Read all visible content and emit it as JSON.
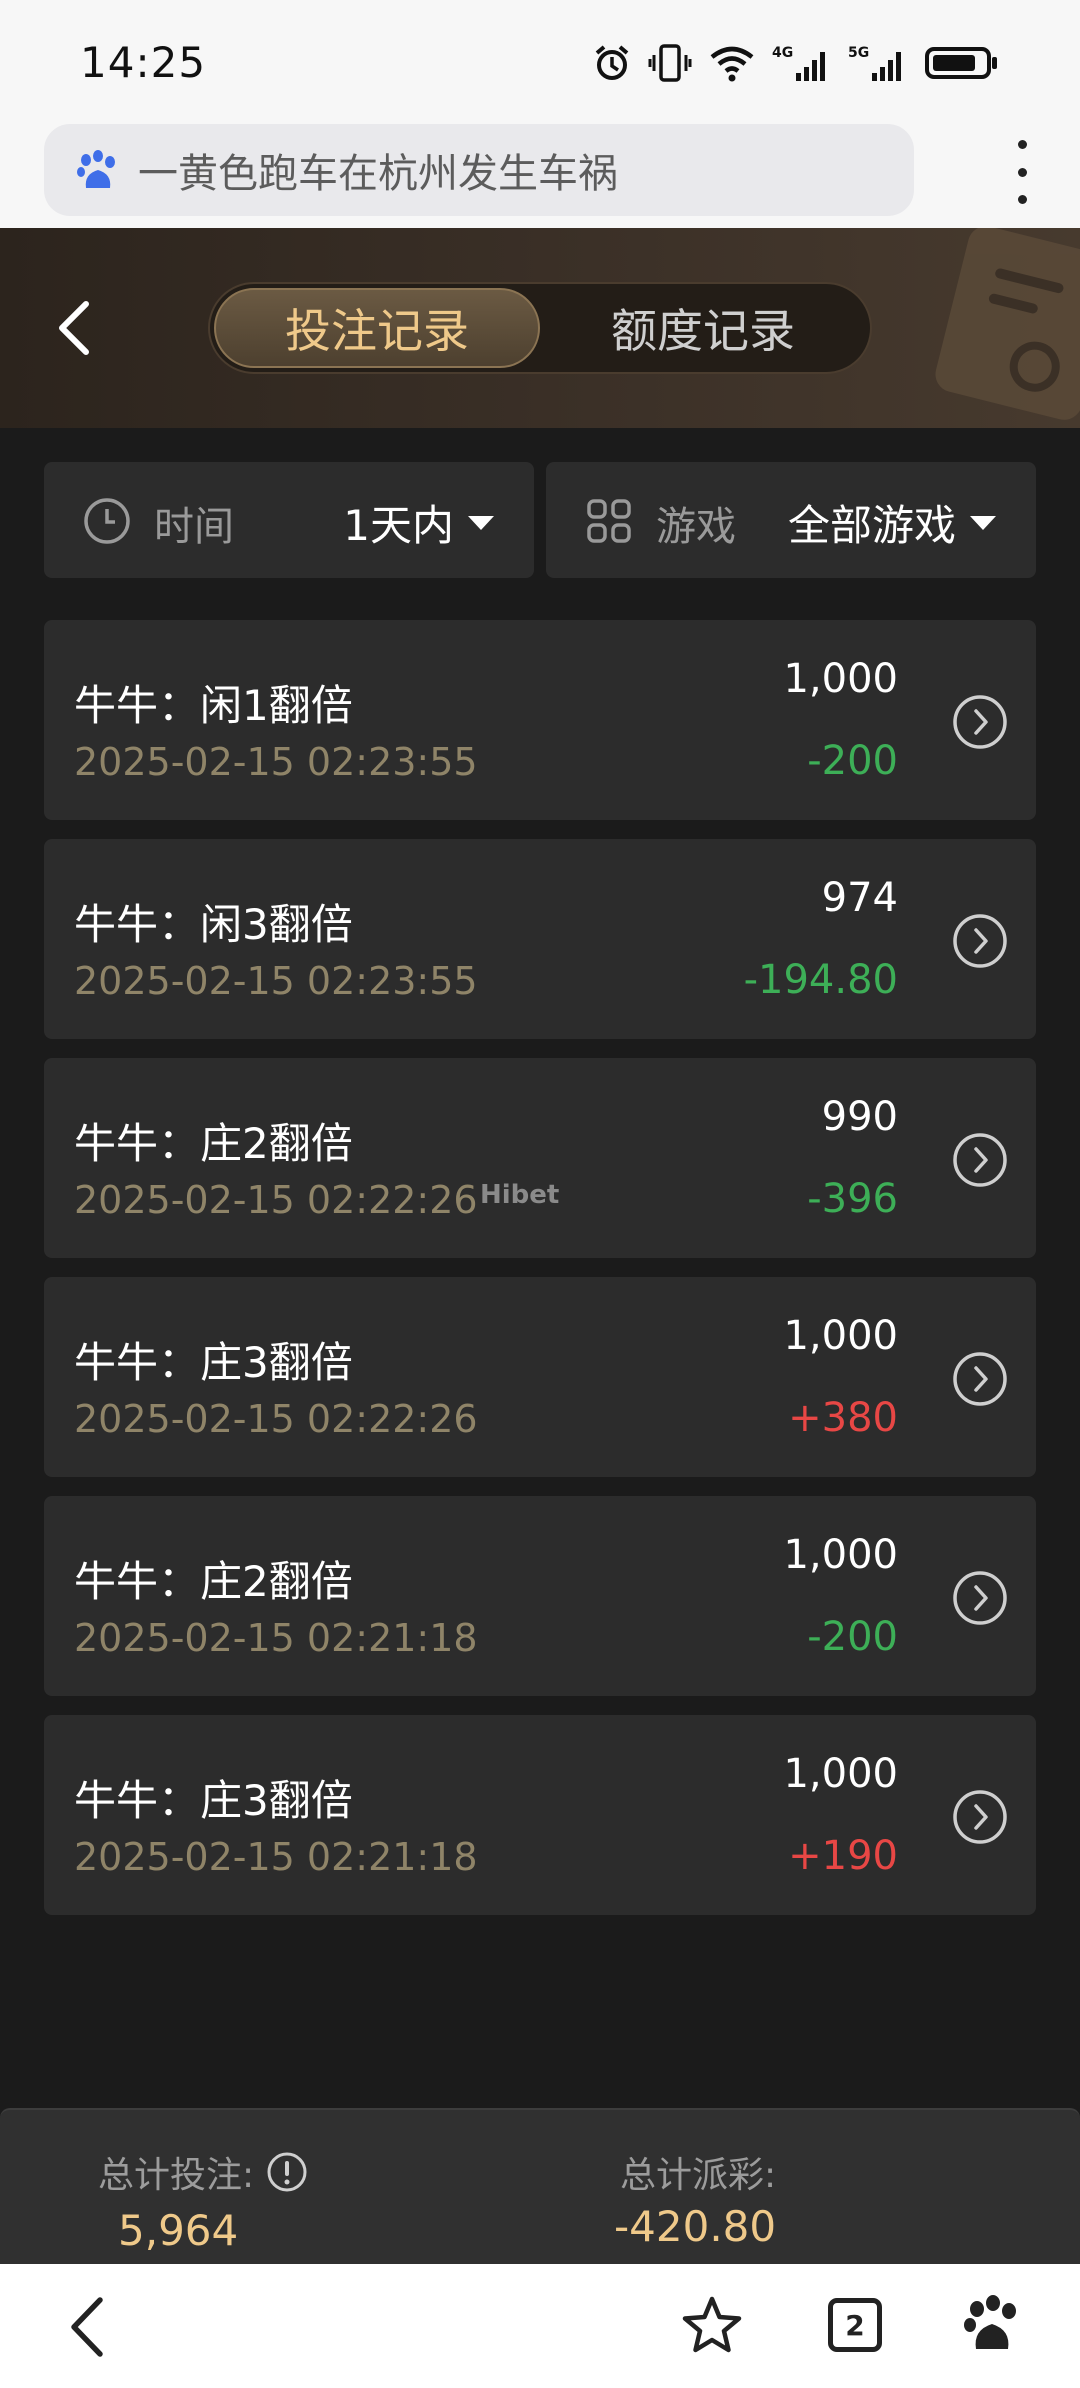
{
  "status_bar": {
    "time": "14:25",
    "net1": "4G",
    "net2": "5G"
  },
  "browser": {
    "search_text": "一黄色跑车在杭州发生车祸",
    "tab_count": "2"
  },
  "header": {
    "tabs": [
      {
        "label": "投注记录",
        "active": true
      },
      {
        "label": "额度记录",
        "active": false
      }
    ]
  },
  "filters": {
    "time": {
      "label": "时间",
      "value": "1天内"
    },
    "game": {
      "label": "游戏",
      "value": "全部游戏"
    }
  },
  "records": [
    {
      "title": "牛牛：闲1翻倍",
      "time": "2025-02-15 02:23:55",
      "bet": "1,000",
      "payout": "-200"
    },
    {
      "title": "牛牛：闲3翻倍",
      "time": "2025-02-15 02:23:55",
      "bet": "974",
      "payout": "-194.80"
    },
    {
      "title": "牛牛：庄2翻倍",
      "time": "2025-02-15 02:22:26",
      "bet": "990",
      "payout": "-396"
    },
    {
      "title": "牛牛：庄3翻倍",
      "time": "2025-02-15 02:22:26",
      "bet": "1,000",
      "payout": "+380"
    },
    {
      "title": "牛牛：庄2翻倍",
      "time": "2025-02-15 02:21:18",
      "bet": "1,000",
      "payout": "-200"
    },
    {
      "title": "牛牛：庄3翻倍",
      "time": "2025-02-15 02:21:18",
      "bet": "1,000",
      "payout": "+190"
    }
  ],
  "watermark": "Hibet",
  "totals": {
    "bet_label": "总计投注:",
    "bet_value": "5,964",
    "payout_label": "总计派彩:",
    "payout_value": "-420.80"
  },
  "colors": {
    "accent_gold": "#efc98a",
    "loss_green": "#3daf57",
    "win_red": "#e84745",
    "background": "#1b1b1b"
  }
}
